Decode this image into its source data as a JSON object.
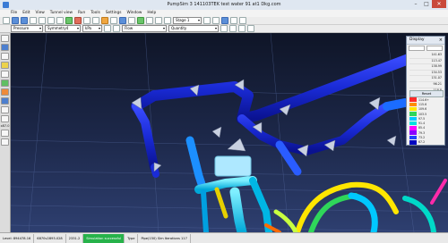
{
  "window": {
    "title": "PumpSim 3  141103TEK test water  91 at1 Dkg.com"
  },
  "menu": [
    "File",
    "Edit",
    "View",
    "Tunnel view",
    "Run",
    "Tools",
    "Settings",
    "Window",
    "Help"
  ],
  "toolbar1": {
    "stage_select": "Stage 1"
  },
  "toolbar2": {
    "field1": "Pressure",
    "field2": "Symmetry4",
    "field3": "kPa",
    "field4": "Flow",
    "field5": "Quantity"
  },
  "left_panel": {
    "scale_label": "x87.0"
  },
  "display_panel": {
    "title": "Display",
    "close": "×",
    "values": [
      "141.63",
      "113.47",
      "138.99",
      "134.53",
      "131.07",
      "96.21",
      "118.8"
    ],
    "reset_label": "Reset",
    "legend": [
      {
        "color": "#ff2a2a",
        "label": "114.6+"
      },
      {
        "color": "#ff8c00",
        "label": "115.6"
      },
      {
        "color": "#ffe600",
        "label": "109.6"
      },
      {
        "color": "#2fd65a",
        "label": "103.5"
      },
      {
        "color": "#00c8ff",
        "label": "97.5"
      },
      {
        "color": "#00e0e0",
        "label": "91.4"
      },
      {
        "color": "#ff00ff",
        "label": "85.4"
      },
      {
        "color": "#8a00ff",
        "label": "79.3"
      },
      {
        "color": "#2040ff",
        "label": "73.2"
      },
      {
        "color": "#0008c0",
        "label": "67.2"
      }
    ]
  },
  "status": {
    "level": "Level: 894478.16",
    "coords": "6870v2893.028",
    "elev": "2331.2",
    "state": "Simulation successful",
    "type_label": "Type",
    "pipe_info": "Pipe(150) Sim Iterations 117"
  },
  "colors": {
    "background_top": "#101528",
    "background_bottom": "#2c3c6b",
    "pipe_blue": "#1a2bd6",
    "accent": "#27b24a"
  }
}
